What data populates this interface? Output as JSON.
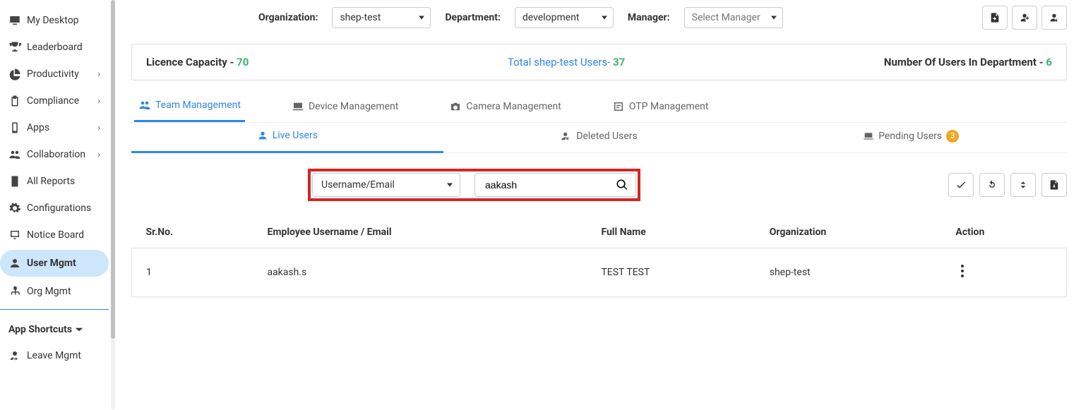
{
  "sidebar": {
    "items": [
      {
        "label": "My Desktop",
        "icon": "monitor-icon"
      },
      {
        "label": "Leaderboard",
        "icon": "trophy-icon"
      },
      {
        "label": "Productivity",
        "icon": "pie-icon",
        "expandable": true
      },
      {
        "label": "Compliance",
        "icon": "clipboard-icon",
        "expandable": true
      },
      {
        "label": "Apps",
        "icon": "phone-icon",
        "expandable": true
      },
      {
        "label": "Collaboration",
        "icon": "group-icon",
        "expandable": true
      },
      {
        "label": "All Reports",
        "icon": "report-icon"
      },
      {
        "label": "Configurations",
        "icon": "gear-icon"
      },
      {
        "label": "Notice Board",
        "icon": "board-icon"
      },
      {
        "label": "User Mgmt",
        "icon": "users-icon",
        "active": true
      },
      {
        "label": "Org Mgmt",
        "icon": "org-icon"
      }
    ],
    "shortcuts_label": "App Shortcuts",
    "shortcut_items": [
      {
        "label": "Leave Mgmt",
        "icon": "leave-icon"
      }
    ]
  },
  "filters": {
    "org_label": "Organization:",
    "org_value": "shep-test",
    "dept_label": "Department:",
    "dept_value": "development",
    "mgr_label": "Manager:",
    "mgr_placeholder": "Select Manager"
  },
  "summary": {
    "licence_label": "Licence Capacity - ",
    "licence_value": "70",
    "total_label": "Total shep-test Users- ",
    "total_value": "37",
    "dept_users_label": "Number Of Users In Department - ",
    "dept_users_value": "6"
  },
  "tabs1": [
    {
      "label": "Team Management",
      "icon": "team-icon",
      "active": true
    },
    {
      "label": "Device Management",
      "icon": "laptop-icon"
    },
    {
      "label": "Camera Management",
      "icon": "camera-icon"
    },
    {
      "label": "OTP Management",
      "icon": "otp-icon"
    }
  ],
  "tabs2": [
    {
      "label": "Live Users",
      "icon": "live-user-icon",
      "active": true
    },
    {
      "label": "Deleted Users",
      "icon": "deleted-user-icon"
    },
    {
      "label": "Pending Users",
      "icon": "pending-user-icon",
      "badge": "3"
    }
  ],
  "search": {
    "filter_label": "Username/Email",
    "value": "aakash"
  },
  "table": {
    "headers": {
      "sr": "Sr.No.",
      "user": "Employee Username / Email",
      "name": "Full Name",
      "org": "Organization",
      "action": "Action"
    },
    "rows": [
      {
        "sr": "1",
        "user": "aakash.s",
        "name": "TEST TEST",
        "org": "shep-test"
      }
    ]
  }
}
